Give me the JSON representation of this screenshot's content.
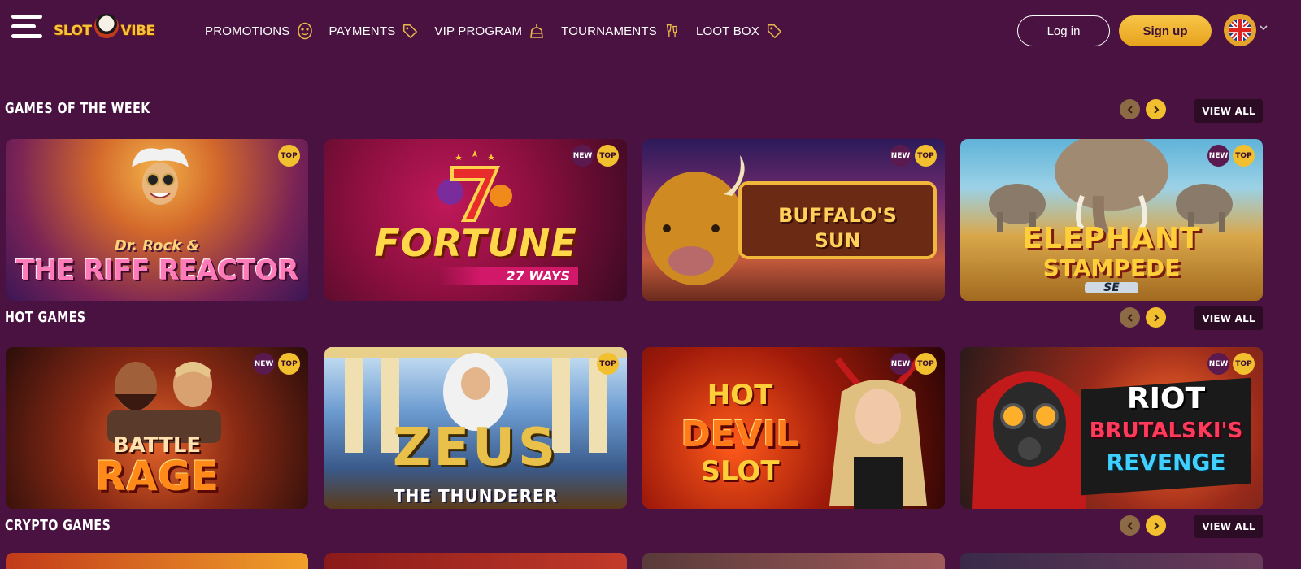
{
  "header": {
    "logo_text_left": "SLOT",
    "logo_text_right": "VIBE",
    "nav": [
      {
        "label": "PROMOTIONS",
        "icon": "mask-icon"
      },
      {
        "label": "PAYMENTS",
        "icon": "tag-icon"
      },
      {
        "label": "VIP PROGRAM",
        "icon": "cake-icon"
      },
      {
        "label": "TOURNAMENTS",
        "icon": "trophy-icon"
      },
      {
        "label": "LOOT BOX",
        "icon": "tag-icon"
      }
    ],
    "login_label": "Log in",
    "signup_label": "Sign up",
    "language_icon": "uk-flag-icon"
  },
  "sections": [
    {
      "title": "GAMES OF THE WEEK",
      "view_all": "VIEW ALL",
      "games": [
        {
          "name_line1": "Dr. Rock &",
          "name_line2": "THE RIFF REACTOR",
          "badges": [
            "TOP"
          ]
        },
        {
          "name_line1": "FORTUNE",
          "name_line2": "27 WAYS",
          "badges": [
            "NEW",
            "TOP"
          ]
        },
        {
          "name_line1": "BUFFALO'S",
          "name_line2": "SUN",
          "badges": [
            "NEW",
            "TOP"
          ]
        },
        {
          "name_line1": "ELEPHANT",
          "name_line2": "STAMPEDE",
          "name_line3": "SE",
          "badges": [
            "NEW",
            "TOP"
          ]
        }
      ]
    },
    {
      "title": "HOT GAMES",
      "view_all": "VIEW ALL",
      "games": [
        {
          "name_line1": "BATTLE",
          "name_line2": "RAGE",
          "badges": [
            "NEW",
            "TOP"
          ]
        },
        {
          "name_line1": "ZEUS",
          "name_line2": "THE THUNDERER",
          "badges": [
            "TOP"
          ]
        },
        {
          "name_line1": "HOT",
          "name_line2": "DEVIL",
          "name_line3": "SLOT",
          "badges": [
            "NEW",
            "TOP"
          ]
        },
        {
          "name_line1": "RIOT",
          "name_line2": "BRUTALSKI'S",
          "name_line3": "REVENGE",
          "badges": [
            "NEW",
            "TOP"
          ]
        }
      ]
    },
    {
      "title": "CRYPTO GAMES",
      "view_all": "VIEW ALL"
    }
  ],
  "colors": {
    "background": "#4a1240",
    "accent_gold": "#f2c02f",
    "view_all_bg": "#2c0b25"
  }
}
